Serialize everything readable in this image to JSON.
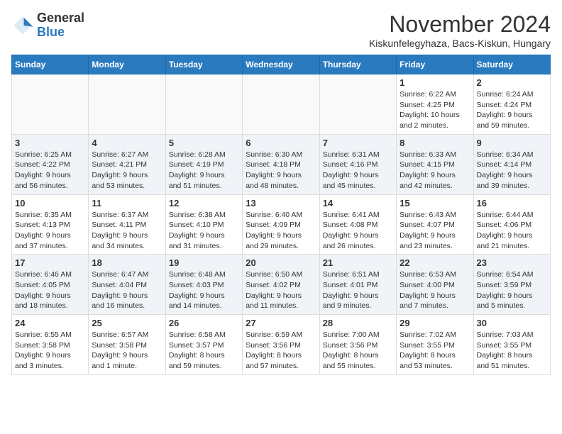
{
  "logo": {
    "general": "General",
    "blue": "Blue"
  },
  "header": {
    "month_year": "November 2024",
    "location": "Kiskunfelegyhaza, Bacs-Kiskun, Hungary"
  },
  "days_of_week": [
    "Sunday",
    "Monday",
    "Tuesday",
    "Wednesday",
    "Thursday",
    "Friday",
    "Saturday"
  ],
  "weeks": [
    [
      {
        "day": "",
        "info": ""
      },
      {
        "day": "",
        "info": ""
      },
      {
        "day": "",
        "info": ""
      },
      {
        "day": "",
        "info": ""
      },
      {
        "day": "",
        "info": ""
      },
      {
        "day": "1",
        "info": "Sunrise: 6:22 AM\nSunset: 4:25 PM\nDaylight: 10 hours\nand 2 minutes."
      },
      {
        "day": "2",
        "info": "Sunrise: 6:24 AM\nSunset: 4:24 PM\nDaylight: 9 hours\nand 59 minutes."
      }
    ],
    [
      {
        "day": "3",
        "info": "Sunrise: 6:25 AM\nSunset: 4:22 PM\nDaylight: 9 hours\nand 56 minutes."
      },
      {
        "day": "4",
        "info": "Sunrise: 6:27 AM\nSunset: 4:21 PM\nDaylight: 9 hours\nand 53 minutes."
      },
      {
        "day": "5",
        "info": "Sunrise: 6:28 AM\nSunset: 4:19 PM\nDaylight: 9 hours\nand 51 minutes."
      },
      {
        "day": "6",
        "info": "Sunrise: 6:30 AM\nSunset: 4:18 PM\nDaylight: 9 hours\nand 48 minutes."
      },
      {
        "day": "7",
        "info": "Sunrise: 6:31 AM\nSunset: 4:16 PM\nDaylight: 9 hours\nand 45 minutes."
      },
      {
        "day": "8",
        "info": "Sunrise: 6:33 AM\nSunset: 4:15 PM\nDaylight: 9 hours\nand 42 minutes."
      },
      {
        "day": "9",
        "info": "Sunrise: 6:34 AM\nSunset: 4:14 PM\nDaylight: 9 hours\nand 39 minutes."
      }
    ],
    [
      {
        "day": "10",
        "info": "Sunrise: 6:35 AM\nSunset: 4:13 PM\nDaylight: 9 hours\nand 37 minutes."
      },
      {
        "day": "11",
        "info": "Sunrise: 6:37 AM\nSunset: 4:11 PM\nDaylight: 9 hours\nand 34 minutes."
      },
      {
        "day": "12",
        "info": "Sunrise: 6:38 AM\nSunset: 4:10 PM\nDaylight: 9 hours\nand 31 minutes."
      },
      {
        "day": "13",
        "info": "Sunrise: 6:40 AM\nSunset: 4:09 PM\nDaylight: 9 hours\nand 29 minutes."
      },
      {
        "day": "14",
        "info": "Sunrise: 6:41 AM\nSunset: 4:08 PM\nDaylight: 9 hours\nand 26 minutes."
      },
      {
        "day": "15",
        "info": "Sunrise: 6:43 AM\nSunset: 4:07 PM\nDaylight: 9 hours\nand 23 minutes."
      },
      {
        "day": "16",
        "info": "Sunrise: 6:44 AM\nSunset: 4:06 PM\nDaylight: 9 hours\nand 21 minutes."
      }
    ],
    [
      {
        "day": "17",
        "info": "Sunrise: 6:46 AM\nSunset: 4:05 PM\nDaylight: 9 hours\nand 18 minutes."
      },
      {
        "day": "18",
        "info": "Sunrise: 6:47 AM\nSunset: 4:04 PM\nDaylight: 9 hours\nand 16 minutes."
      },
      {
        "day": "19",
        "info": "Sunrise: 6:48 AM\nSunset: 4:03 PM\nDaylight: 9 hours\nand 14 minutes."
      },
      {
        "day": "20",
        "info": "Sunrise: 6:50 AM\nSunset: 4:02 PM\nDaylight: 9 hours\nand 11 minutes."
      },
      {
        "day": "21",
        "info": "Sunrise: 6:51 AM\nSunset: 4:01 PM\nDaylight: 9 hours\nand 9 minutes."
      },
      {
        "day": "22",
        "info": "Sunrise: 6:53 AM\nSunset: 4:00 PM\nDaylight: 9 hours\nand 7 minutes."
      },
      {
        "day": "23",
        "info": "Sunrise: 6:54 AM\nSunset: 3:59 PM\nDaylight: 9 hours\nand 5 minutes."
      }
    ],
    [
      {
        "day": "24",
        "info": "Sunrise: 6:55 AM\nSunset: 3:58 PM\nDaylight: 9 hours\nand 3 minutes."
      },
      {
        "day": "25",
        "info": "Sunrise: 6:57 AM\nSunset: 3:58 PM\nDaylight: 9 hours\nand 1 minute."
      },
      {
        "day": "26",
        "info": "Sunrise: 6:58 AM\nSunset: 3:57 PM\nDaylight: 8 hours\nand 59 minutes."
      },
      {
        "day": "27",
        "info": "Sunrise: 6:59 AM\nSunset: 3:56 PM\nDaylight: 8 hours\nand 57 minutes."
      },
      {
        "day": "28",
        "info": "Sunrise: 7:00 AM\nSunset: 3:56 PM\nDaylight: 8 hours\nand 55 minutes."
      },
      {
        "day": "29",
        "info": "Sunrise: 7:02 AM\nSunset: 3:55 PM\nDaylight: 8 hours\nand 53 minutes."
      },
      {
        "day": "30",
        "info": "Sunrise: 7:03 AM\nSunset: 3:55 PM\nDaylight: 8 hours\nand 51 minutes."
      }
    ]
  ]
}
